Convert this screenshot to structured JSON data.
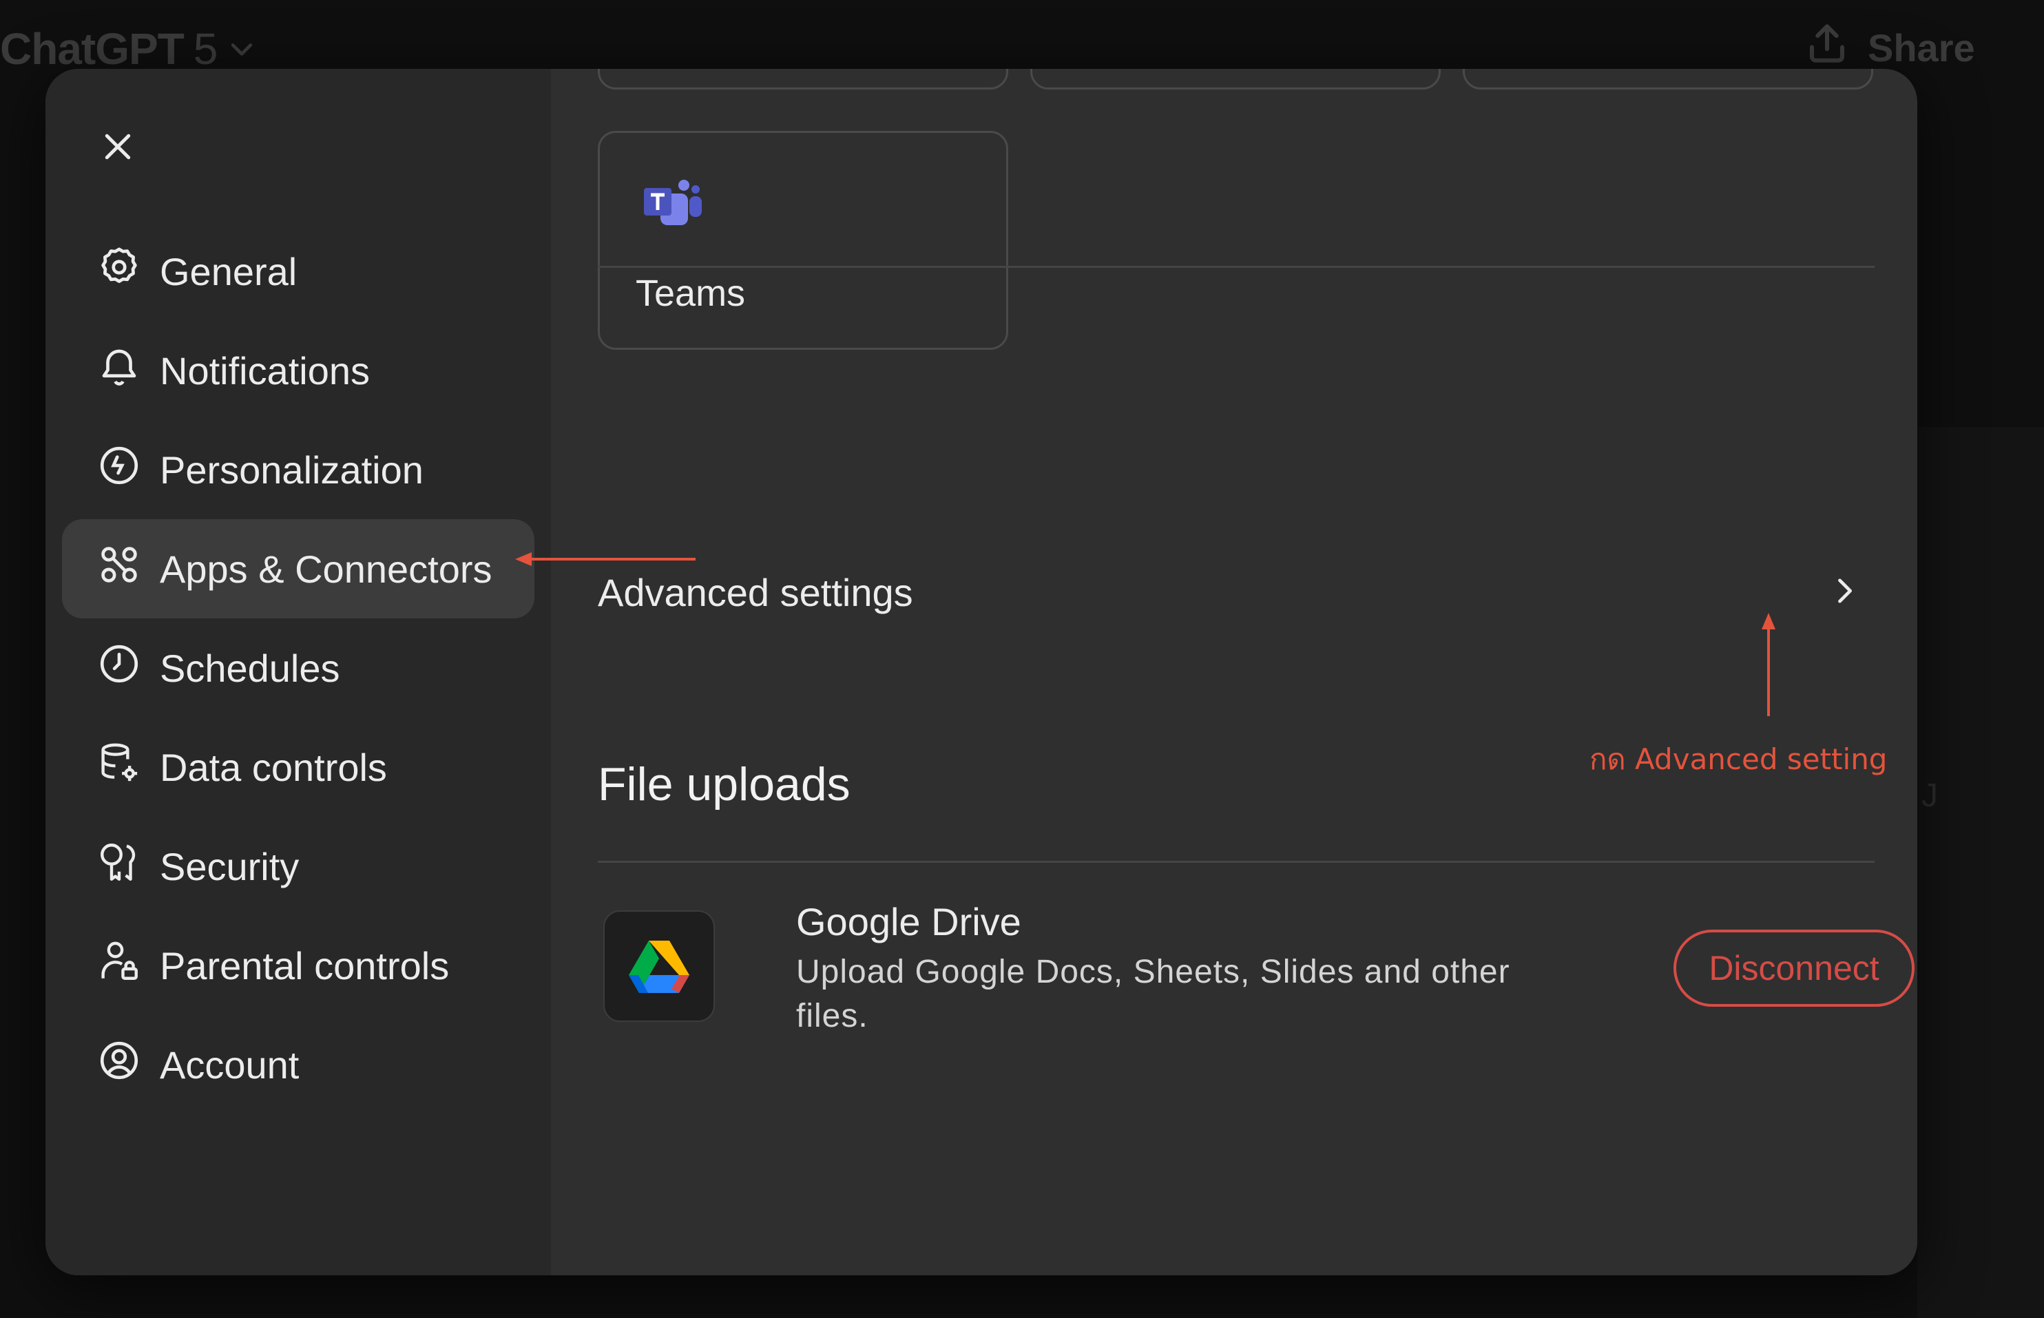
{
  "app": {
    "title": "ChatGPT",
    "version": "5",
    "share_label": "Share",
    "bg_fragment": "J"
  },
  "icons": {
    "close": "close-icon",
    "model_dropdown": "chevron-down-icon",
    "share": "upload-icon",
    "advanced": "chevron-right-icon"
  },
  "sidebar": {
    "items": [
      {
        "label": "General",
        "icon": "gear-icon",
        "active": false
      },
      {
        "label": "Notifications",
        "icon": "bell-icon",
        "active": false
      },
      {
        "label": "Personalization",
        "icon": "personalization-icon",
        "active": false
      },
      {
        "label": "Apps & Connectors",
        "icon": "apps-icon",
        "active": true
      },
      {
        "label": "Schedules",
        "icon": "clock-icon",
        "active": false
      },
      {
        "label": "Data controls",
        "icon": "database-gear-icon",
        "active": false
      },
      {
        "label": "Security",
        "icon": "key-icon",
        "active": false
      },
      {
        "label": "Parental controls",
        "icon": "parental-icon",
        "active": false
      },
      {
        "label": "Account",
        "icon": "account-icon",
        "active": false
      }
    ]
  },
  "main": {
    "connector_cards": [
      {
        "label": "Teams",
        "icon": "teams-logo"
      }
    ],
    "advanced_settings_label": "Advanced settings",
    "file_uploads": {
      "title": "File uploads",
      "items": [
        {
          "name": "Google Drive",
          "icon": "google-drive-logo",
          "description": "Upload Google Docs, Sheets, Slides and other files.",
          "action_label": "Disconnect"
        }
      ]
    }
  },
  "annotation": {
    "note": "กด Advanced setting",
    "color": "#e5533c"
  },
  "colors": {
    "modal_bg": "#2f2f2f",
    "sidebar_bg": "#282828",
    "active_item_bg": "#3c3c3c",
    "danger": "#d64c46"
  }
}
